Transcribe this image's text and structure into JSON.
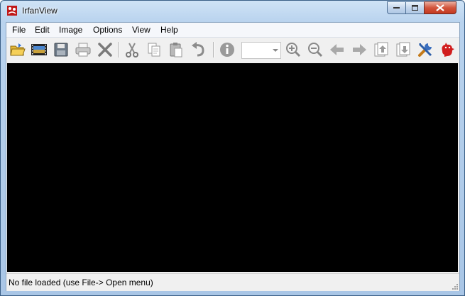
{
  "window": {
    "title": "IrfanView"
  },
  "menu": {
    "items": [
      "File",
      "Edit",
      "Image",
      "Options",
      "View",
      "Help"
    ]
  },
  "toolbar": {
    "buttons": [
      "open-folder-icon",
      "slideshow-icon",
      "save-icon",
      "print-icon",
      "delete-icon",
      "cut-icon",
      "copy-icon",
      "paste-icon",
      "undo-icon",
      "info-icon",
      "zoom-in-icon",
      "zoom-out-icon",
      "previous-icon",
      "next-icon",
      "first-file-icon",
      "last-file-icon",
      "properties-icon",
      "about-icon"
    ],
    "zoom_value": ""
  },
  "statusbar": {
    "text": "No file loaded (use File-> Open menu)"
  },
  "colors": {
    "canvas": "#000000",
    "accent": "#2f6fd0",
    "close_button": "#c3381f"
  }
}
